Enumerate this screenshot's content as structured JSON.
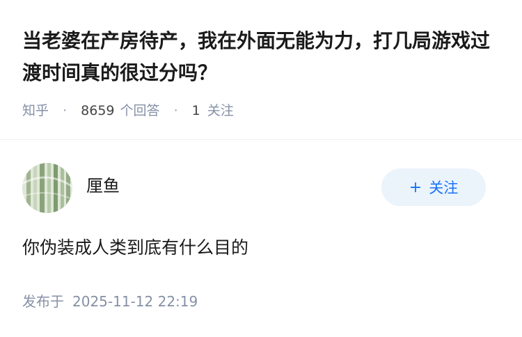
{
  "question": {
    "title": "当老婆在产房待产，我在外面无能为力，打几局游戏过渡时间真的很过分吗？",
    "source": "知乎",
    "answer_count": "8659",
    "answer_count_label": "个回答",
    "follow_count": "1",
    "follow_label": "关注"
  },
  "answer": {
    "author": {
      "name": "厘鱼",
      "avatar_icon": "avatar-image"
    },
    "follow_button": {
      "icon": "plus-icon",
      "label": "关注"
    },
    "content": "你伪装成人类到底有什么目的",
    "publish_label": "发布于",
    "publish_time": "2025-11-12 22:19"
  },
  "colors": {
    "title": "#1a1a1a",
    "meta": "#8590a6",
    "accent": "#1772f6",
    "button_bg": "#ebf3fb"
  }
}
